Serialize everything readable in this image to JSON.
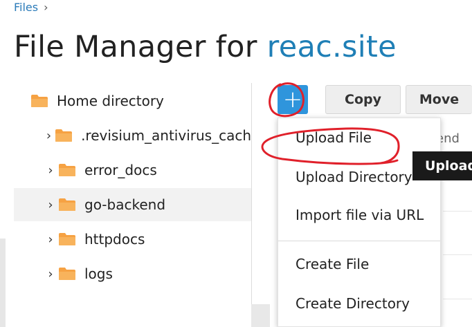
{
  "breadcrumb": {
    "root": "Files",
    "separator": "›"
  },
  "header": {
    "title_prefix": "File Manager for ",
    "title_site": "reac.site"
  },
  "tree": {
    "items": [
      {
        "label": "Home directory",
        "icon": "folder-icon",
        "expandable": false,
        "selected": false
      },
      {
        "label": ".revisium_antivirus_cach",
        "icon": "folder-icon",
        "expandable": true,
        "selected": false
      },
      {
        "label": "error_docs",
        "icon": "folder-icon",
        "expandable": true,
        "selected": false
      },
      {
        "label": "go-backend",
        "icon": "folder-icon",
        "expandable": true,
        "selected": true
      },
      {
        "label": "httpdocs",
        "icon": "folder-icon",
        "expandable": true,
        "selected": false
      },
      {
        "label": "logs",
        "icon": "folder-icon",
        "expandable": true,
        "selected": false
      }
    ],
    "caret": "›"
  },
  "toolbar": {
    "add_label": "+",
    "copy_label": "Copy",
    "move_label": "Move"
  },
  "background": {
    "partial_text": "end"
  },
  "dropdown": {
    "items": [
      "Upload File",
      "Upload Directory",
      "Import file via URL",
      "Create File",
      "Create Directory"
    ]
  },
  "tooltip": {
    "text": "Upload"
  },
  "colors": {
    "accent": "#2f95dc",
    "link": "#1f7fb6",
    "folder": "#f6a243",
    "annotation": "#e0202a",
    "tooltip_bg": "#1a1a1a"
  }
}
